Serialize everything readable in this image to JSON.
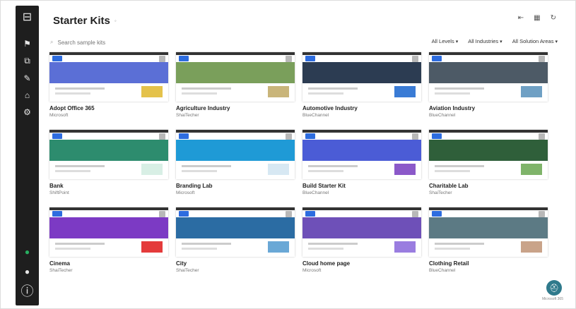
{
  "page": {
    "title": "Starter Kits",
    "title_info": "◦"
  },
  "sidebar": {
    "logo_glyph": "⊟",
    "items": [
      {
        "name": "pin-icon",
        "glyph": "⚑"
      },
      {
        "name": "apps-icon",
        "glyph": "⧉"
      },
      {
        "name": "pencil-icon",
        "glyph": "✎"
      },
      {
        "name": "home-icon",
        "glyph": "⌂"
      },
      {
        "name": "settings-icon",
        "glyph": "⚙"
      }
    ],
    "bottom": [
      {
        "name": "status-icon",
        "glyph": "●",
        "color": "#27ae60"
      },
      {
        "name": "user-icon",
        "glyph": "●"
      },
      {
        "name": "info-icon",
        "glyph": "ⓘ"
      }
    ]
  },
  "top_actions": [
    "⇤",
    "▦",
    "↻"
  ],
  "search": {
    "placeholder": "Search sample kits",
    "icon": "⌕"
  },
  "filters": [
    {
      "label": "All Levels"
    },
    {
      "label": "All Industries"
    },
    {
      "label": "All Solution Areas"
    }
  ],
  "cards": [
    {
      "title": "Adopt Office 365",
      "subtitle": "Microsoft",
      "theme": "#5b6fd6",
      "accent": "#e4c24b",
      "badge_color": "#2d6cdf"
    },
    {
      "title": "Agriculture Industry",
      "subtitle": "ShaiTecher",
      "theme": "#7a9f5b",
      "accent": "#c9b57a",
      "badge_color": "#2d6cdf"
    },
    {
      "title": "Automotive Industry",
      "subtitle": "BlueChannel",
      "theme": "#2c3c52",
      "accent": "#3a7bd5",
      "badge_color": "#2d6cdf"
    },
    {
      "title": "Aviation Industry",
      "subtitle": "BlueChannel",
      "theme": "#4d5a66",
      "accent": "#6fa0c4",
      "badge_color": "#2d6cdf"
    },
    {
      "title": "Bank",
      "subtitle": "ShiftPoint",
      "theme": "#2d8c6e",
      "accent": "#d8efe5",
      "badge_color": "#2d6cdf"
    },
    {
      "title": "Branding Lab",
      "subtitle": "Microsoft",
      "theme": "#1f9ad6",
      "accent": "#d7e8f3",
      "badge_color": "#2d6cdf"
    },
    {
      "title": "Build Starter Kit",
      "subtitle": "BlueChannel",
      "theme": "#4b5cd6",
      "accent": "#8b59c9",
      "badge_color": "#2d6cdf"
    },
    {
      "title": "Charitable Lab",
      "subtitle": "ShaiTecher",
      "theme": "#2f5f3a",
      "accent": "#7fb46a",
      "badge_color": "#2d6cdf"
    },
    {
      "title": "Cinema",
      "subtitle": "ShaiTecher",
      "theme": "#7c3ac4",
      "accent": "#e43b3b",
      "badge_color": "#2d6cdf"
    },
    {
      "title": "City",
      "subtitle": "ShaiTecher",
      "theme": "#2b6ca3",
      "accent": "#6aa8d6",
      "badge_color": "#2d6cdf"
    },
    {
      "title": "Cloud home page",
      "subtitle": "Microsoft",
      "theme": "#6e50b8",
      "accent": "#9a7de0",
      "badge_color": "#2d6cdf"
    },
    {
      "title": "Clothing Retail",
      "subtitle": "BlueChannel",
      "theme": "#5c7a84",
      "accent": "#c9a389",
      "badge_color": "#2d6cdf"
    }
  ],
  "avatar": {
    "glyph": "⛑",
    "caption": "Microsoft 365"
  }
}
